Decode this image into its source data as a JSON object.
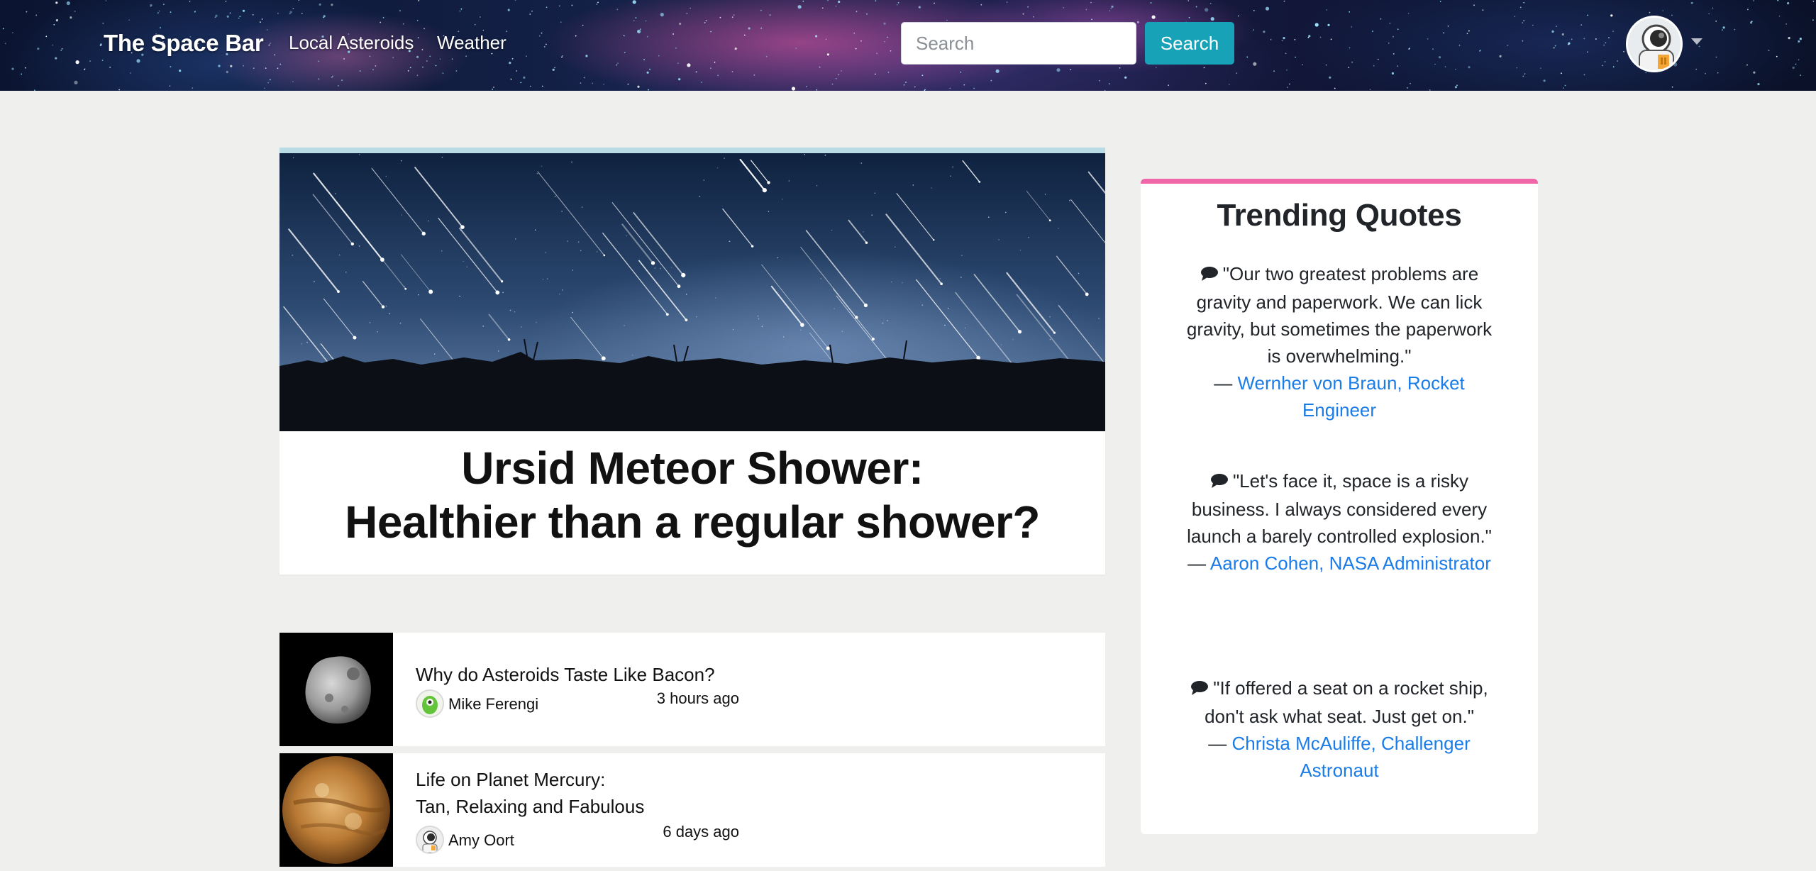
{
  "navbar": {
    "brand": "The Space Bar",
    "links": [
      "Local Asteroids",
      "Weather"
    ],
    "search": {
      "placeholder": "Search",
      "value": "",
      "button_label": "Search"
    },
    "user_menu_icon": "astronaut-avatar-icon"
  },
  "hero": {
    "image_icon": "meteor-shower-photo",
    "title_line1": "Ursid Meteor Shower:",
    "title_line2": "Healthier than a regular shower?"
  },
  "articles": [
    {
      "title_line1": "Why do Asteroids Taste Like Bacon?",
      "title_line2": "",
      "author": "Mike Ferengi",
      "time": "3 hours ago",
      "thumb_icon": "asteroid-photo",
      "author_icon": "alien-avatar-icon"
    },
    {
      "title_line1": "Life on Planet Mercury:",
      "title_line2": "Tan, Relaxing and Fabulous",
      "author": "Amy Oort",
      "time": "6 days ago",
      "thumb_icon": "planet-photo",
      "author_icon": "astronaut-avatar-icon"
    }
  ],
  "trending": {
    "heading": "Trending Quotes",
    "quotes": [
      {
        "text": "\"Our two greatest problems are gravity and paperwork. We can lick gravity, but sometimes the paperwork is overwhelming.\"",
        "dash": "—",
        "author": "Wernher von Braun, Rocket Engineer"
      },
      {
        "text": "\"Let's face it, space is a risky business. I always considered every launch a barely controlled explosion.\"",
        "dash": "—",
        "author": "Aaron Cohen, NASA Administrator"
      },
      {
        "text": "\"If offered a seat on a rocket ship, don't ask what seat. Just get on.\"",
        "dash": "—",
        "author": "Christa McAuliffe, Challenger Astronaut"
      }
    ]
  },
  "colors": {
    "search_button": "#17a2b8",
    "quotes_accent": "#ef67a8",
    "hero_accent": "#b9dbe6",
    "link": "#1b7ce8",
    "page_bg": "#efefee"
  }
}
